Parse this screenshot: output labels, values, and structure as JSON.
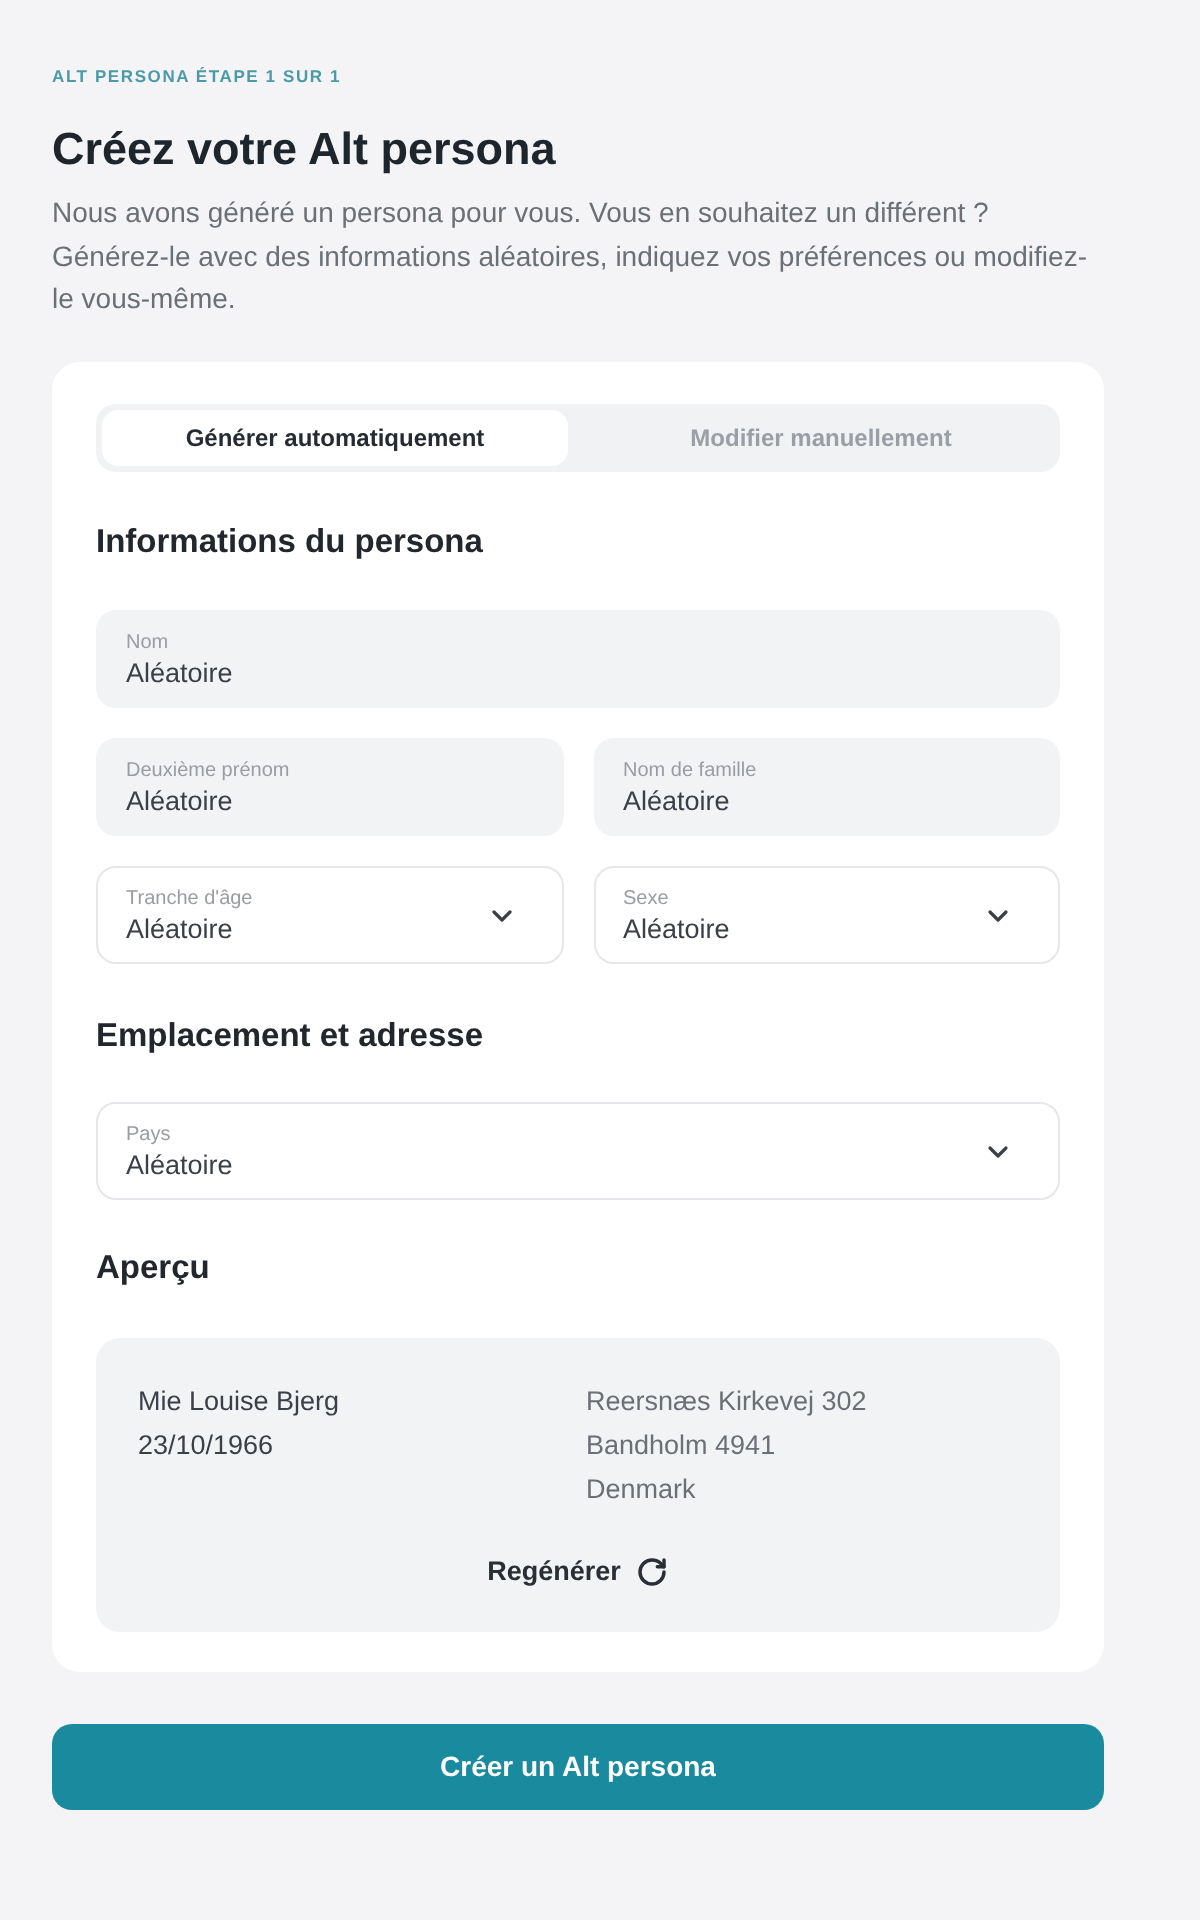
{
  "header": {
    "step": "ALT PERSONA ÉTAPE 1 SUR 1",
    "title": "Créez votre Alt persona",
    "description": "Nous avons généré un persona pour vous. Vous en souhaitez un différent ? Générez-le avec des informations aléatoires, indiquez vos préférences ou modifiez-le vous-même."
  },
  "card": {
    "tabs": [
      {
        "label": "Générer automatiquement",
        "selected": true
      },
      {
        "label": "Modifier manuellement",
        "selected": false
      }
    ],
    "sections": [
      {
        "heading": "Informations du persona",
        "rows": [
          [
            {
              "kind": "text",
              "label": "Nom",
              "value": "Aléatoire"
            }
          ],
          [
            {
              "kind": "text",
              "label": "Deuxième prénom",
              "value": "Aléatoire"
            },
            {
              "kind": "text",
              "label": "Nom de famille",
              "value": "Aléatoire"
            }
          ],
          [
            {
              "kind": "select",
              "label": "Tranche d'âge",
              "value": "Aléatoire"
            },
            {
              "kind": "select",
              "label": "Sexe",
              "value": "Aléatoire"
            }
          ]
        ]
      },
      {
        "heading": "Emplacement et adresse",
        "rows": [
          [
            {
              "kind": "select",
              "label": "Pays",
              "value": "Aléatoire"
            }
          ]
        ]
      }
    ],
    "preview": {
      "heading": "Aperçu",
      "identity": [
        "Mie Louise Bjerg",
        "23/10/1966"
      ],
      "address": [
        "Reersnæs Kirkevej 302",
        "Bandholm 4941",
        "Denmark"
      ],
      "regenerate": "Regénérer"
    }
  },
  "submit": "Créer un Alt persona"
}
